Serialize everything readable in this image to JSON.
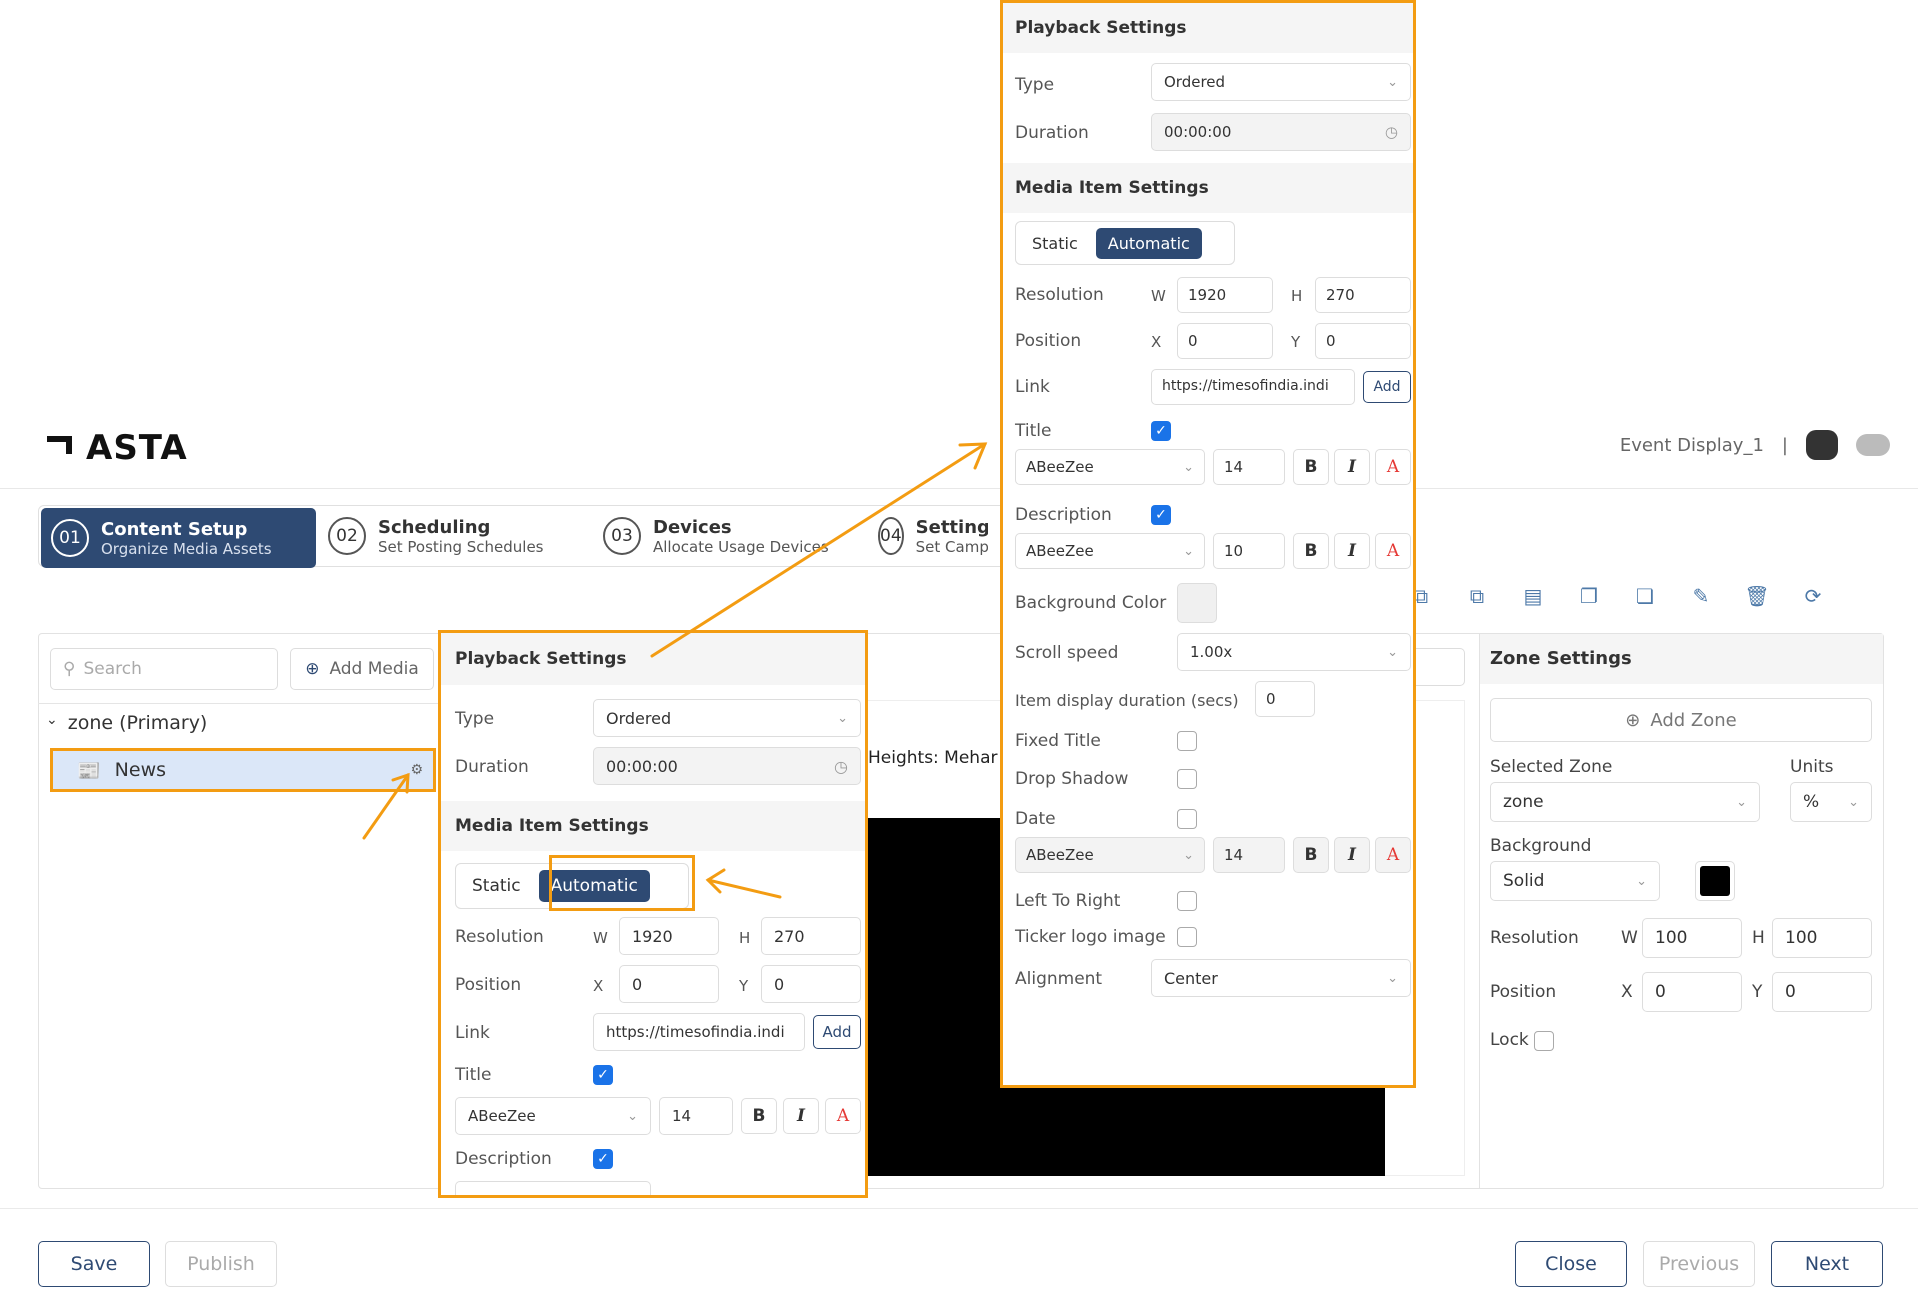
{
  "app": {
    "logo": "ASTA",
    "event_name": "Event Display_1",
    "separator": "|"
  },
  "steps": [
    {
      "num": "01",
      "title": "Content Setup",
      "subtitle": "Organize Media Assets"
    },
    {
      "num": "02",
      "title": "Scheduling",
      "subtitle": "Set Posting Schedules"
    },
    {
      "num": "03",
      "title": "Devices",
      "subtitle": "Allocate Usage Devices"
    },
    {
      "num": "04",
      "title": "Settings",
      "subtitle": "Set Camp"
    }
  ],
  "left": {
    "search_placeholder": "Search",
    "add_media": "Add Media",
    "zone_label": "zone (Primary)",
    "item": "News"
  },
  "preview": {
    "text": "Heights: Mehar Si"
  },
  "zone_settings": {
    "title": "Zone Settings",
    "add_zone": "Add Zone",
    "selected_zone_label": "Selected Zone",
    "selected_zone": "zone",
    "units_label": "Units",
    "units": "%",
    "background_label": "Background",
    "background": "Solid",
    "bg_color": "#000000",
    "resolution_label": "Resolution",
    "w_label": "W",
    "w": "100",
    "h_label": "H",
    "h": "100",
    "position_label": "Position",
    "x_label": "X",
    "x": "0",
    "y_label": "Y",
    "y": "0",
    "lock_label": "Lock"
  },
  "footer": {
    "save": "Save",
    "publish": "Publish",
    "close": "Close",
    "previous": "Previous",
    "next": "Next"
  },
  "panel": {
    "playback": "Playback Settings",
    "type_label": "Type",
    "type": "Ordered",
    "duration_label": "Duration",
    "duration": "00:00:00",
    "media": "Media Item Settings",
    "static": "Static",
    "automatic": "Automatic",
    "resolution_label": "Resolution",
    "w_label": "W",
    "w": "1920",
    "h_label": "H",
    "h": "270",
    "position_label": "Position",
    "x_label": "X",
    "x": "0",
    "y_label": "Y",
    "y": "0",
    "link_label": "Link",
    "link": "https://timesofindia.indi",
    "link_small": "https://timesofindia.indi",
    "add": "Add",
    "title_label": "Title",
    "font": "ABeeZee",
    "title_size": "14",
    "desc_label": "Description",
    "desc_size": "10",
    "bold": "B",
    "italic": "I",
    "color": "A",
    "bgcolor_label": "Background Color",
    "scroll_label": "Scroll speed",
    "scroll": "1.00x",
    "item_dur_label": "Item display duration (secs)",
    "item_dur": "0",
    "fixed_title": "Fixed Title",
    "drop_shadow": "Drop Shadow",
    "date_label": "Date",
    "date_size": "14",
    "ltr": "Left To Right",
    "ticker": "Ticker logo image",
    "align_label": "Alignment",
    "align": "Center"
  },
  "colors": {
    "accent": "#2e4a73",
    "highlight": "#f39c12",
    "check": "#1a73e8"
  }
}
